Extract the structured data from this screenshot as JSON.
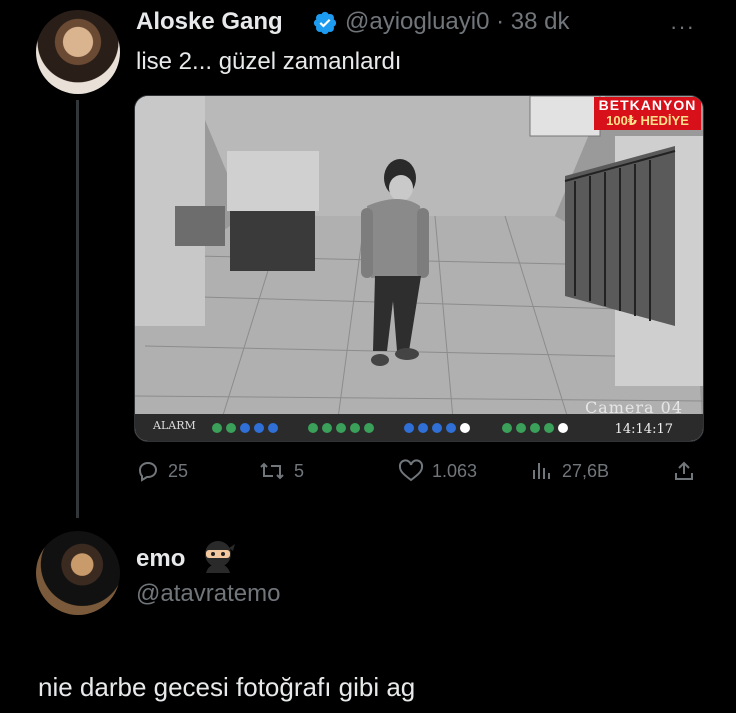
{
  "tweet": {
    "author_name": "Aloske Gang",
    "handle": "@ayiogluayi0",
    "time": "· 38 dk",
    "text": "lise 2... güzel zamanlardı",
    "more_icon": "more-icon",
    "media": {
      "promo_line1": "BETKANYON",
      "promo_line2": "100₺ HEDİYE",
      "camera_label": "Camera 04",
      "camera_time": "14:14:17",
      "alarm_label": "ALARM"
    },
    "stats": {
      "replies": "25",
      "retweets": "5",
      "likes": "1.063",
      "views": "27,6B"
    },
    "accent_color": "#1d9bf0"
  },
  "reply": {
    "author_name": "emo",
    "emoji_icon": "ninja-emoji-icon",
    "handle": "@atavratemo",
    "text": "nie darbe gecesi fotoğrafı gibi ag"
  }
}
